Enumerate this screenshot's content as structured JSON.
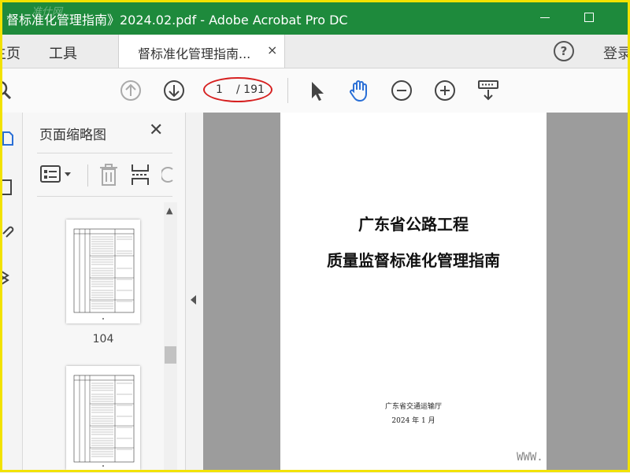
{
  "window": {
    "title": "督标准化管理指南》2024.02.pdf - Adobe Acrobat Pro DC",
    "watermark": "准仕网"
  },
  "menubar": {
    "home": "主页",
    "tools": "工具",
    "doc_tab": "督标准化管理指南...",
    "tab_close": "×",
    "help": "?",
    "login": "登录"
  },
  "toolbar": {
    "current_page": "1",
    "total_pages": "/ 191"
  },
  "thumbnails": {
    "title": "页面缩略图",
    "close": "✕",
    "items": [
      {
        "label": "104"
      },
      {
        "label": ""
      }
    ]
  },
  "document": {
    "title_line1": "广东省公路工程",
    "title_line2": "质量监督标准化管理指南",
    "org": "广东省交通运输厅",
    "date": "2024 年 1 月",
    "watermark": "WWW."
  },
  "colors": {
    "titlebar": "#1e8a3c",
    "frame": "#f2e200",
    "annotation": "#d62020",
    "hand_tool": "#2a6fd6"
  }
}
